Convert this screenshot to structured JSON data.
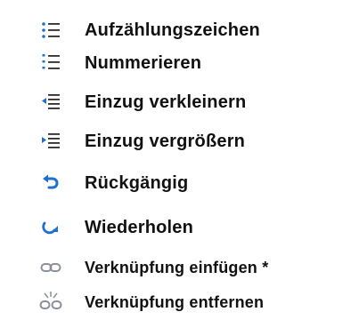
{
  "menu": {
    "items": [
      {
        "label": "Aufzählungszeichen",
        "icon": "bullet-list-icon"
      },
      {
        "label": "Nummerieren",
        "icon": "numbered-list-icon"
      },
      {
        "label": "Einzug verkleinern",
        "icon": "outdent-icon"
      },
      {
        "label": "Einzug vergrößern",
        "icon": "indent-icon"
      },
      {
        "label": "Rückgängig",
        "icon": "undo-icon"
      },
      {
        "label": "Wiederholen",
        "icon": "redo-icon"
      },
      {
        "label": "Verknüpfung einfügen *",
        "icon": "link-icon"
      },
      {
        "label": "Verknüpfung entfernen",
        "icon": "unlink-icon"
      }
    ]
  },
  "colors": {
    "icon_blue": "#1f6fd1",
    "icon_gray": "#8a8f99",
    "text": "#111111"
  }
}
